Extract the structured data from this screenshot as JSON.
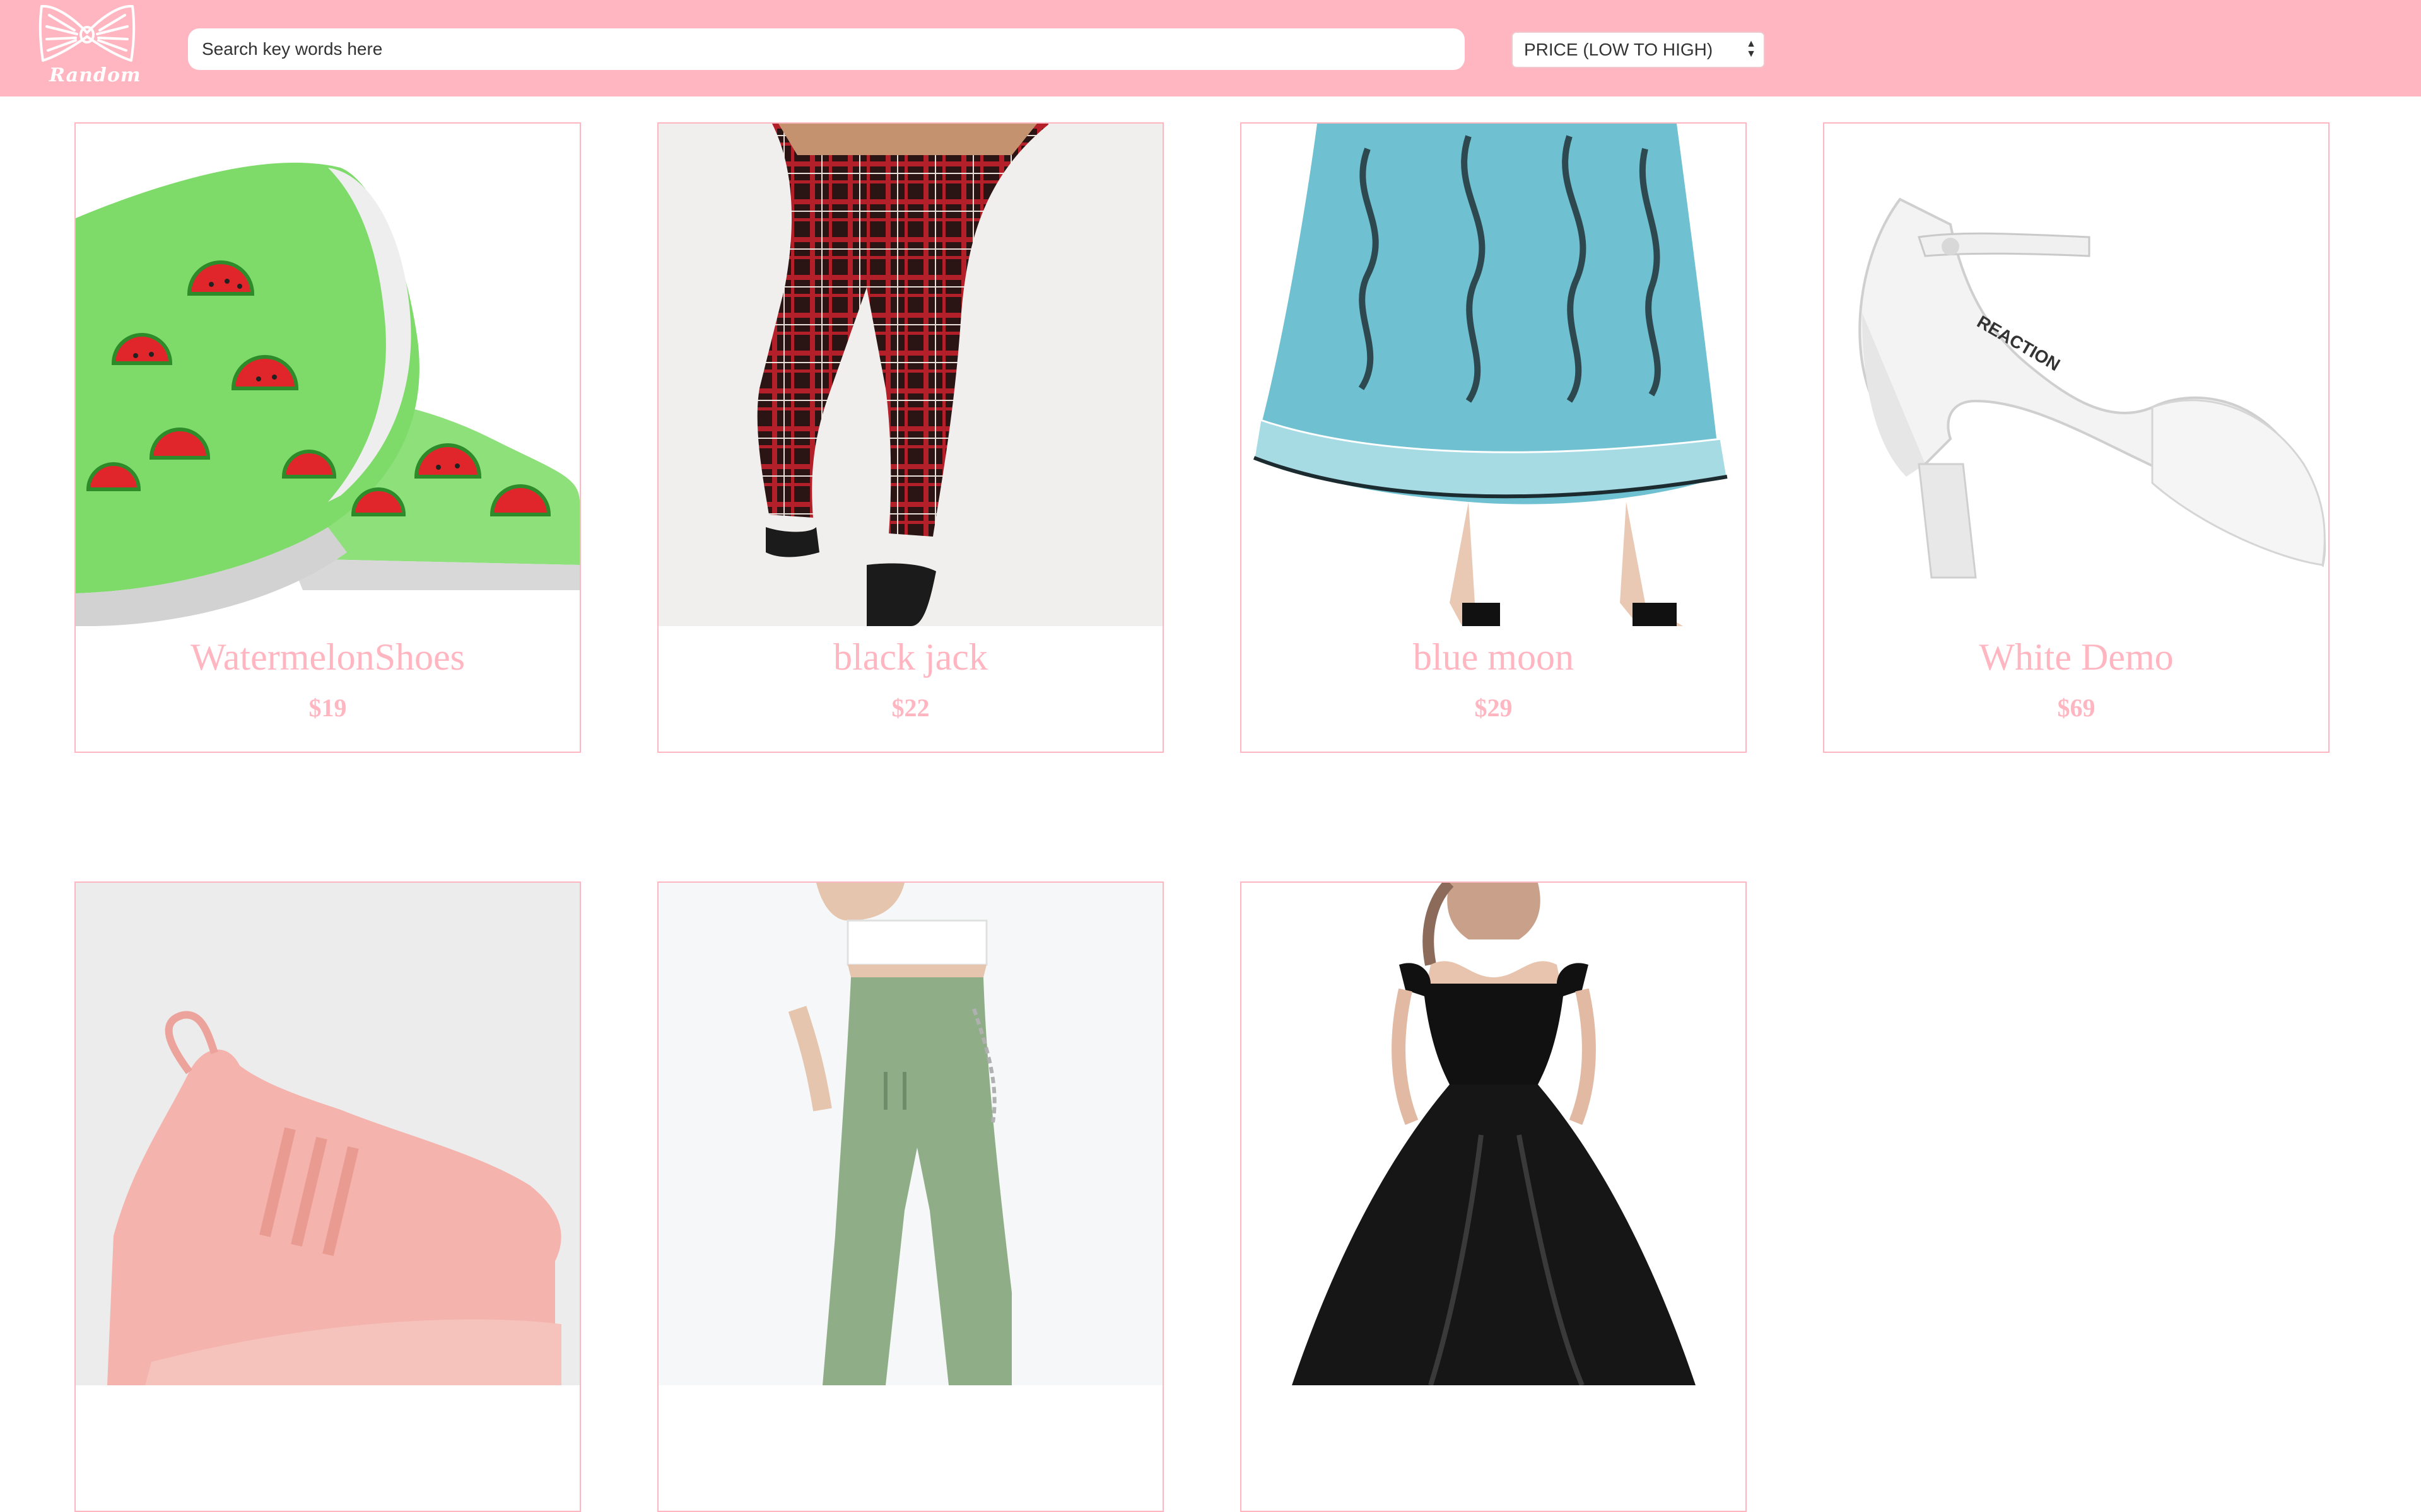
{
  "header": {
    "logo_text": "Random",
    "search_placeholder": "Search key words here",
    "sort_selected": "PRICE (LOW TO HIGH)",
    "background_color": "#ffb6c1"
  },
  "products": [
    {
      "name": "WatermelonShoes",
      "price": "$19",
      "image": "green-watermelon-slip-on-shoes"
    },
    {
      "name": "black jack",
      "price": "$22",
      "image": "red-plaid-pants"
    },
    {
      "name": "blue moon",
      "price": "$29",
      "image": "blue-paisley-skirt"
    },
    {
      "name": "White Demo",
      "price": "$69",
      "image": "white-glitter-heel"
    },
    {
      "name": "",
      "price": "",
      "image": "pink-sneaker"
    },
    {
      "name": "",
      "price": "",
      "image": "green-cargo-pants-outfit"
    },
    {
      "name": "",
      "price": "",
      "image": "black-off-shoulder-gown"
    }
  ],
  "colors": {
    "accent": "#ffb6c1",
    "text": "#333333"
  }
}
